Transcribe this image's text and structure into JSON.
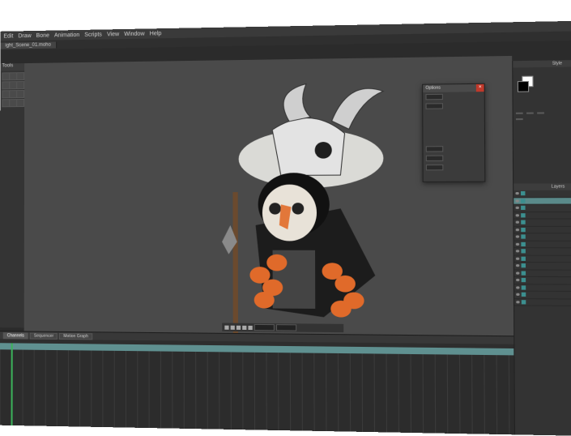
{
  "menu": [
    "Edit",
    "Draw",
    "Bone",
    "Animation",
    "Scripts",
    "View",
    "Window",
    "Help"
  ],
  "doc_tab": "ight_Scene_01.moho",
  "tools_header": "Tools",
  "dialog": {
    "title": "Options"
  },
  "timeline_tabs": [
    "Channels",
    "Sequencer",
    "Motion Graph"
  ],
  "layers_header": "Layers",
  "style_header": "Style"
}
